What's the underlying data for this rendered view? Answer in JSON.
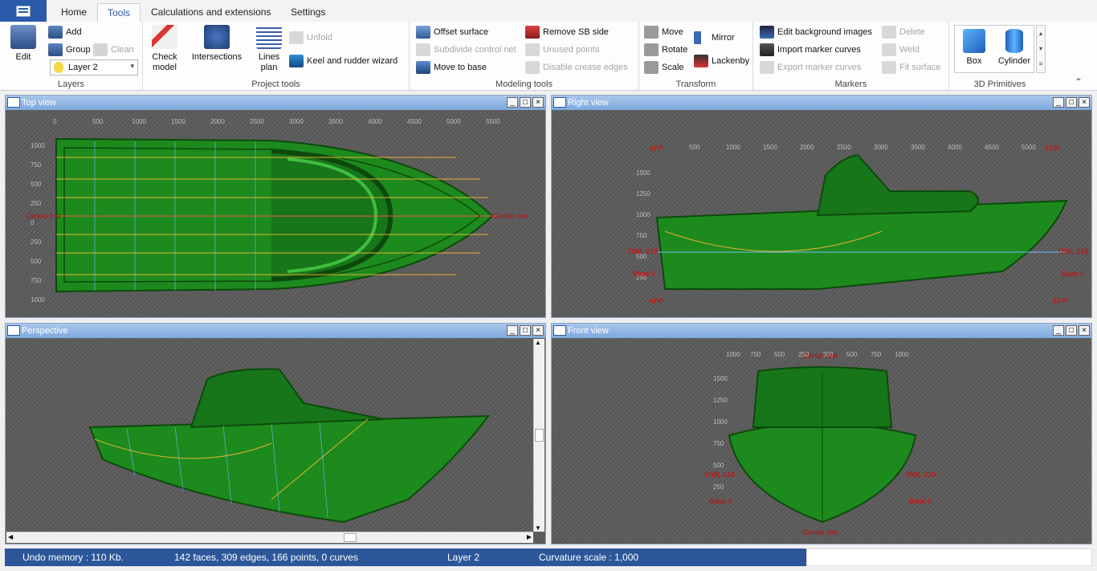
{
  "tabs": {
    "home": "Home",
    "tools": "Tools",
    "calc": "Calculations and extensions",
    "settings": "Settings"
  },
  "layers": {
    "group_label": "Layers",
    "edit": "Edit",
    "add": "Add",
    "group": "Group",
    "clean": "Clean",
    "current_layer": "Layer 2"
  },
  "project": {
    "group_label": "Project tools",
    "check": "Check model",
    "intersections": "Intersections",
    "lines": "Lines plan",
    "unfold": "Unfold",
    "keel": "Keel and rudder wizard"
  },
  "modeling": {
    "group_label": "Modeling tools",
    "offset": "Offset surface",
    "subdivide": "Subdivide control net",
    "move_base": "Move to base",
    "remove_sb": "Remove SB side",
    "unused": "Unused points",
    "disable_crease": "Disable crease edges"
  },
  "transform": {
    "group_label": "Transform",
    "move": "Move",
    "rotate": "Rotate",
    "scale": "Scale",
    "mirror": "Mirror",
    "lackenby": "Lackenby"
  },
  "markers": {
    "group_label": "Markers",
    "edit_bg": "Edit background images",
    "import_curves": "Import marker curves",
    "export_curves": "Export marker curves",
    "delete": "Delete",
    "weld": "Weld",
    "fit": "Fit surface"
  },
  "primitives": {
    "group_label": "3D Primitives",
    "box": "Box",
    "cylinder": "Cylinder"
  },
  "views": {
    "top": "Top view",
    "right": "Right view",
    "perspective": "Perspective",
    "front": "Front view"
  },
  "axes": {
    "top_x": [
      "0",
      "500",
      "1000",
      "1500",
      "2000",
      "2500",
      "3000",
      "3500",
      "4000",
      "4500",
      "5000",
      "5500"
    ],
    "top_y": [
      "1000",
      "750",
      "500",
      "250",
      "0",
      "250",
      "500",
      "750",
      "1000"
    ],
    "side_x": [
      "500",
      "1000",
      "1500",
      "2000",
      "2500",
      "3000",
      "3500",
      "4000",
      "4500",
      "5000"
    ],
    "side_y": [
      "1500",
      "1250",
      "1000",
      "750",
      "500",
      "250"
    ],
    "front_x": [
      "1000",
      "750",
      "500",
      "250",
      "250",
      "500",
      "750",
      "1000"
    ],
    "front_y": [
      "1500",
      "1250",
      "1000",
      "750",
      "500",
      "250"
    ],
    "center_line": "Center line",
    "app": "APP",
    "fpp": "FPP",
    "dwl": "DWL 218",
    "base": "Base 0"
  },
  "status": {
    "undo": "Undo memory : 110 Kb.",
    "stats": "142 faces, 309 edges, 166 points, 0 curves",
    "layer": "Layer 2",
    "curv": "Curvature scale : 1,000"
  },
  "colors": {
    "accent": "#2b579a",
    "hull": "#1f8a1f",
    "label_red": "#e00000"
  }
}
